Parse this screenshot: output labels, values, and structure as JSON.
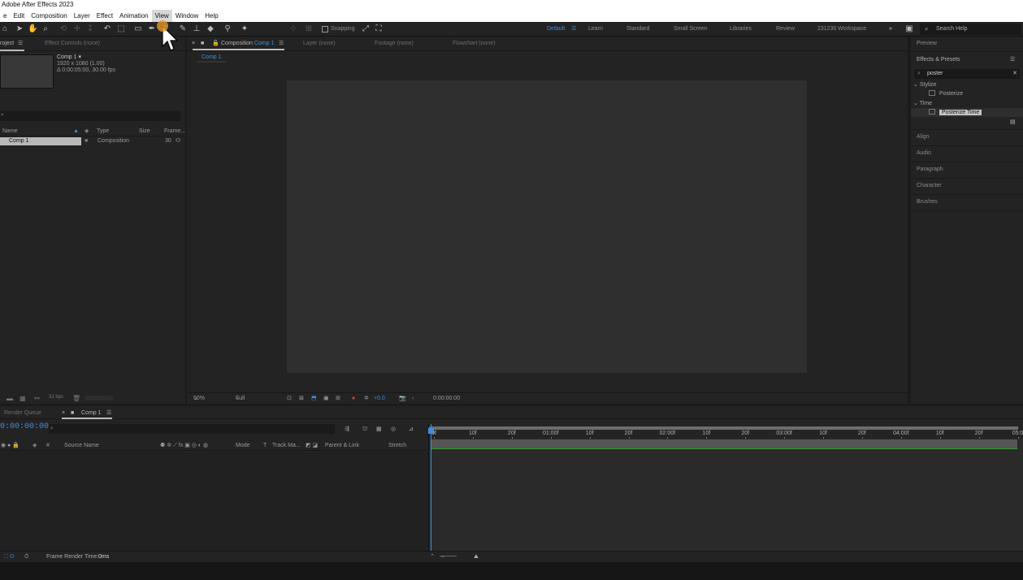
{
  "app": {
    "title": "Adobe After Effects 2023"
  },
  "menu": {
    "items": [
      "e",
      "Edit",
      "Composition",
      "Layer",
      "Effect",
      "Animation",
      "View",
      "Window",
      "Help"
    ]
  },
  "toolbar": {
    "snapping_label": "Snapping",
    "workspaces": [
      "Default",
      "Learn",
      "Standard",
      "Small Screen",
      "Libraries",
      "Review",
      "231230 Workspace"
    ],
    "active_workspace": "Default",
    "search_help": "Search Help"
  },
  "project": {
    "tab_project": "roject",
    "tab_effect_controls": "Effect Controls  (none)",
    "comp_name": "Comp 1 ▾",
    "comp_size": "1920 x 1080 (1.00)",
    "comp_duration": "Δ 0:00:05:00, 30.00 fps",
    "columns": {
      "name": "Name",
      "type": "Type",
      "size": "Size",
      "frame": "Frame..."
    },
    "rows": [
      {
        "name": "Comp 1",
        "type": "Composition",
        "frame": "30"
      }
    ],
    "bpc": "32 bpc"
  },
  "viewer": {
    "tab_composition": "Composition",
    "tab_comp_name": "Comp 1",
    "tab_layer": "Layer  (none)",
    "tab_footage": "Footage  (none)",
    "tab_flowchart": "Flowchart  (none)",
    "subtab": "Comp 1",
    "zoom": "50%",
    "resolution": "Full",
    "exposure": "+0.0",
    "timecode": "0:00:00:00"
  },
  "right_panel": {
    "preview": "Preview",
    "effects_presets": "Effects & Presets",
    "search_value": "poster",
    "groups": [
      {
        "name": "Stylize",
        "items": [
          "Posterize"
        ]
      },
      {
        "name": "Time",
        "items": [
          "Posterize Time"
        ]
      }
    ],
    "selected_item": "Posterize Time",
    "panels": [
      "Align",
      "Audio",
      "Paragraph",
      "Character",
      "Brushes"
    ]
  },
  "timeline": {
    "tab_render_queue": "Render Queue",
    "tab_comp": "Comp 1",
    "timecode": "0:00:00:00",
    "columns": {
      "source_name": "Source Name",
      "mode": "Mode",
      "t": "T",
      "track_matte": "Track Ma...",
      "parent": "Parent & Link",
      "stretch": "Stretch"
    },
    "ruler_labels": [
      "0f",
      "10f",
      "20f",
      "01:00f",
      "10f",
      "20f",
      "02:00f",
      "10f",
      "20f",
      "03:00f",
      "10f",
      "20f",
      "04:00f",
      "10f",
      "20f",
      "05:0"
    ],
    "frame_render_label": "Frame Render Time:",
    "frame_render_value": "0ms"
  }
}
